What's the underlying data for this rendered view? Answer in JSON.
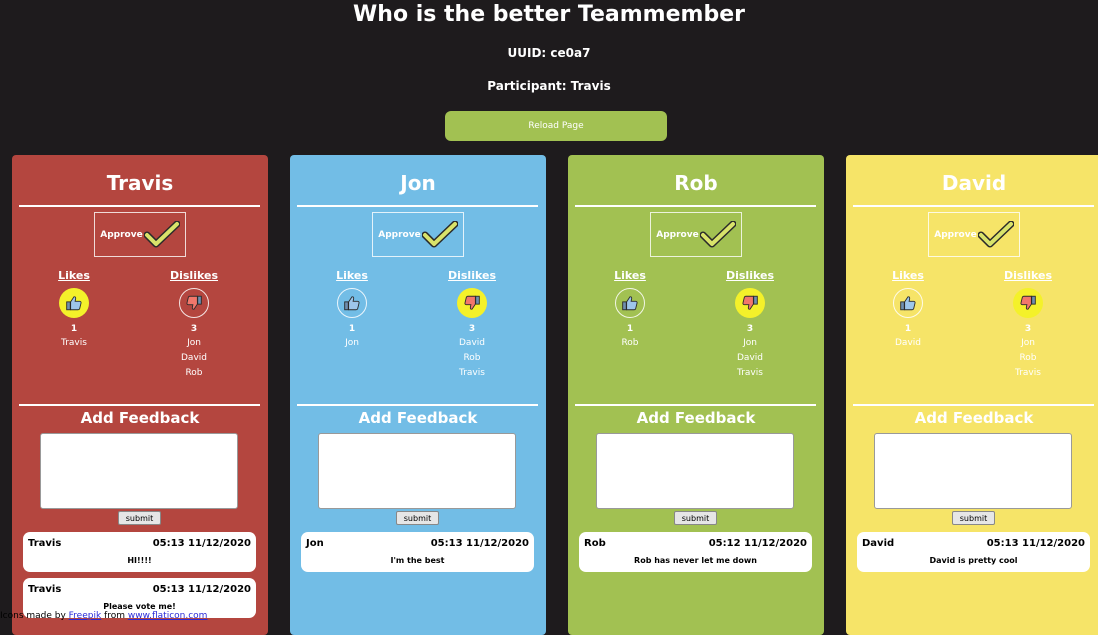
{
  "header": {
    "title": "Who is the better Teammember",
    "uuid": "UUID: ce0a7",
    "participant": "Participant: Travis",
    "reload_label": "Reload Page"
  },
  "labels": {
    "approve": "Approve",
    "likes": "Likes",
    "dislikes": "Dislikes",
    "add_feedback": "Add Feedback",
    "submit": "submit"
  },
  "colors": {
    "travis": "#b4463f",
    "jon": "#72bde6",
    "rob": "#a2c152",
    "david": "#f6e468",
    "background": "#1e1b1d",
    "active_vote": "#f4f12a"
  },
  "cards": [
    {
      "name": "Travis",
      "likes_count": "1",
      "likes_names": [
        "Travis"
      ],
      "dislikes_count": "3",
      "dislikes_names": [
        "Jon",
        "David",
        "Rob"
      ],
      "liked_active": true,
      "disliked_active": false,
      "feedback": [
        {
          "author": "Travis",
          "time": "05:13 11/12/2020",
          "message": "HI!!!!"
        },
        {
          "author": "Travis",
          "time": "05:13 11/12/2020",
          "message": "Please vote me!"
        }
      ]
    },
    {
      "name": "Jon",
      "likes_count": "1",
      "likes_names": [
        "Jon"
      ],
      "dislikes_count": "3",
      "dislikes_names": [
        "David",
        "Rob",
        "Travis"
      ],
      "liked_active": false,
      "disliked_active": true,
      "feedback": [
        {
          "author": "Jon",
          "time": "05:13 11/12/2020",
          "message": "I'm the best"
        }
      ]
    },
    {
      "name": "Rob",
      "likes_count": "1",
      "likes_names": [
        "Rob"
      ],
      "dislikes_count": "3",
      "dislikes_names": [
        "Jon",
        "David",
        "Travis"
      ],
      "liked_active": false,
      "disliked_active": true,
      "feedback": [
        {
          "author": "Rob",
          "time": "05:12 11/12/2020",
          "message": "Rob has never let me down"
        }
      ]
    },
    {
      "name": "David",
      "likes_count": "1",
      "likes_names": [
        "David"
      ],
      "dislikes_count": "3",
      "dislikes_names": [
        "Jon",
        "Rob",
        "Travis"
      ],
      "liked_active": false,
      "disliked_active": true,
      "feedback": [
        {
          "author": "David",
          "time": "05:13 11/12/2020",
          "message": "David is pretty cool"
        }
      ]
    }
  ],
  "footer": {
    "prefix": "Icons made by ",
    "author_link": "Freepik",
    "middle": " from ",
    "site_link": "www.flaticon.com"
  }
}
